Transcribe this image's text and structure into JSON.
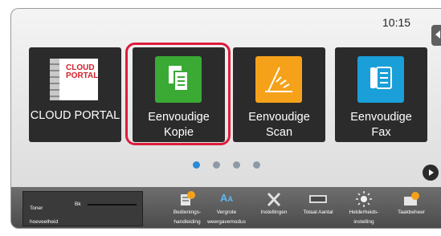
{
  "clock": "10:15",
  "tiles": [
    {
      "label": "CLOUD PORTAL",
      "icon": "cloud-portal-icon",
      "logo_text": "CLOUD PORTAL"
    },
    {
      "label": "Eenvoudige Kopie",
      "icon": "copy-icon",
      "color": "#3aaa35"
    },
    {
      "label": "Eenvoudige Scan",
      "icon": "scan-icon",
      "color": "#f5a21a"
    },
    {
      "label": "Eenvoudige Fax",
      "icon": "fax-icon",
      "color": "#1a9fd8"
    }
  ],
  "toner": {
    "label": "Toner hoeveelheid",
    "color_label": "Bk"
  },
  "bottom_buttons": [
    {
      "label": "Bedienings-handleiding",
      "icon": "manual-icon"
    },
    {
      "label": "Vergrote weergavemodus",
      "icon": "zoom-text-icon"
    },
    {
      "label": "Instellingen",
      "icon": "settings-tools-icon"
    },
    {
      "label": "Totaal Aantal",
      "icon": "counter-icon"
    },
    {
      "label": "Helderheids-instelling",
      "icon": "brightness-icon"
    },
    {
      "label": "Taakbeheer",
      "icon": "job-status-icon"
    }
  ],
  "pagination": {
    "pages": 4,
    "current": 1
  },
  "colors": {
    "highlight": "#dd1c3a",
    "active_dot": "#2a8ad6"
  }
}
